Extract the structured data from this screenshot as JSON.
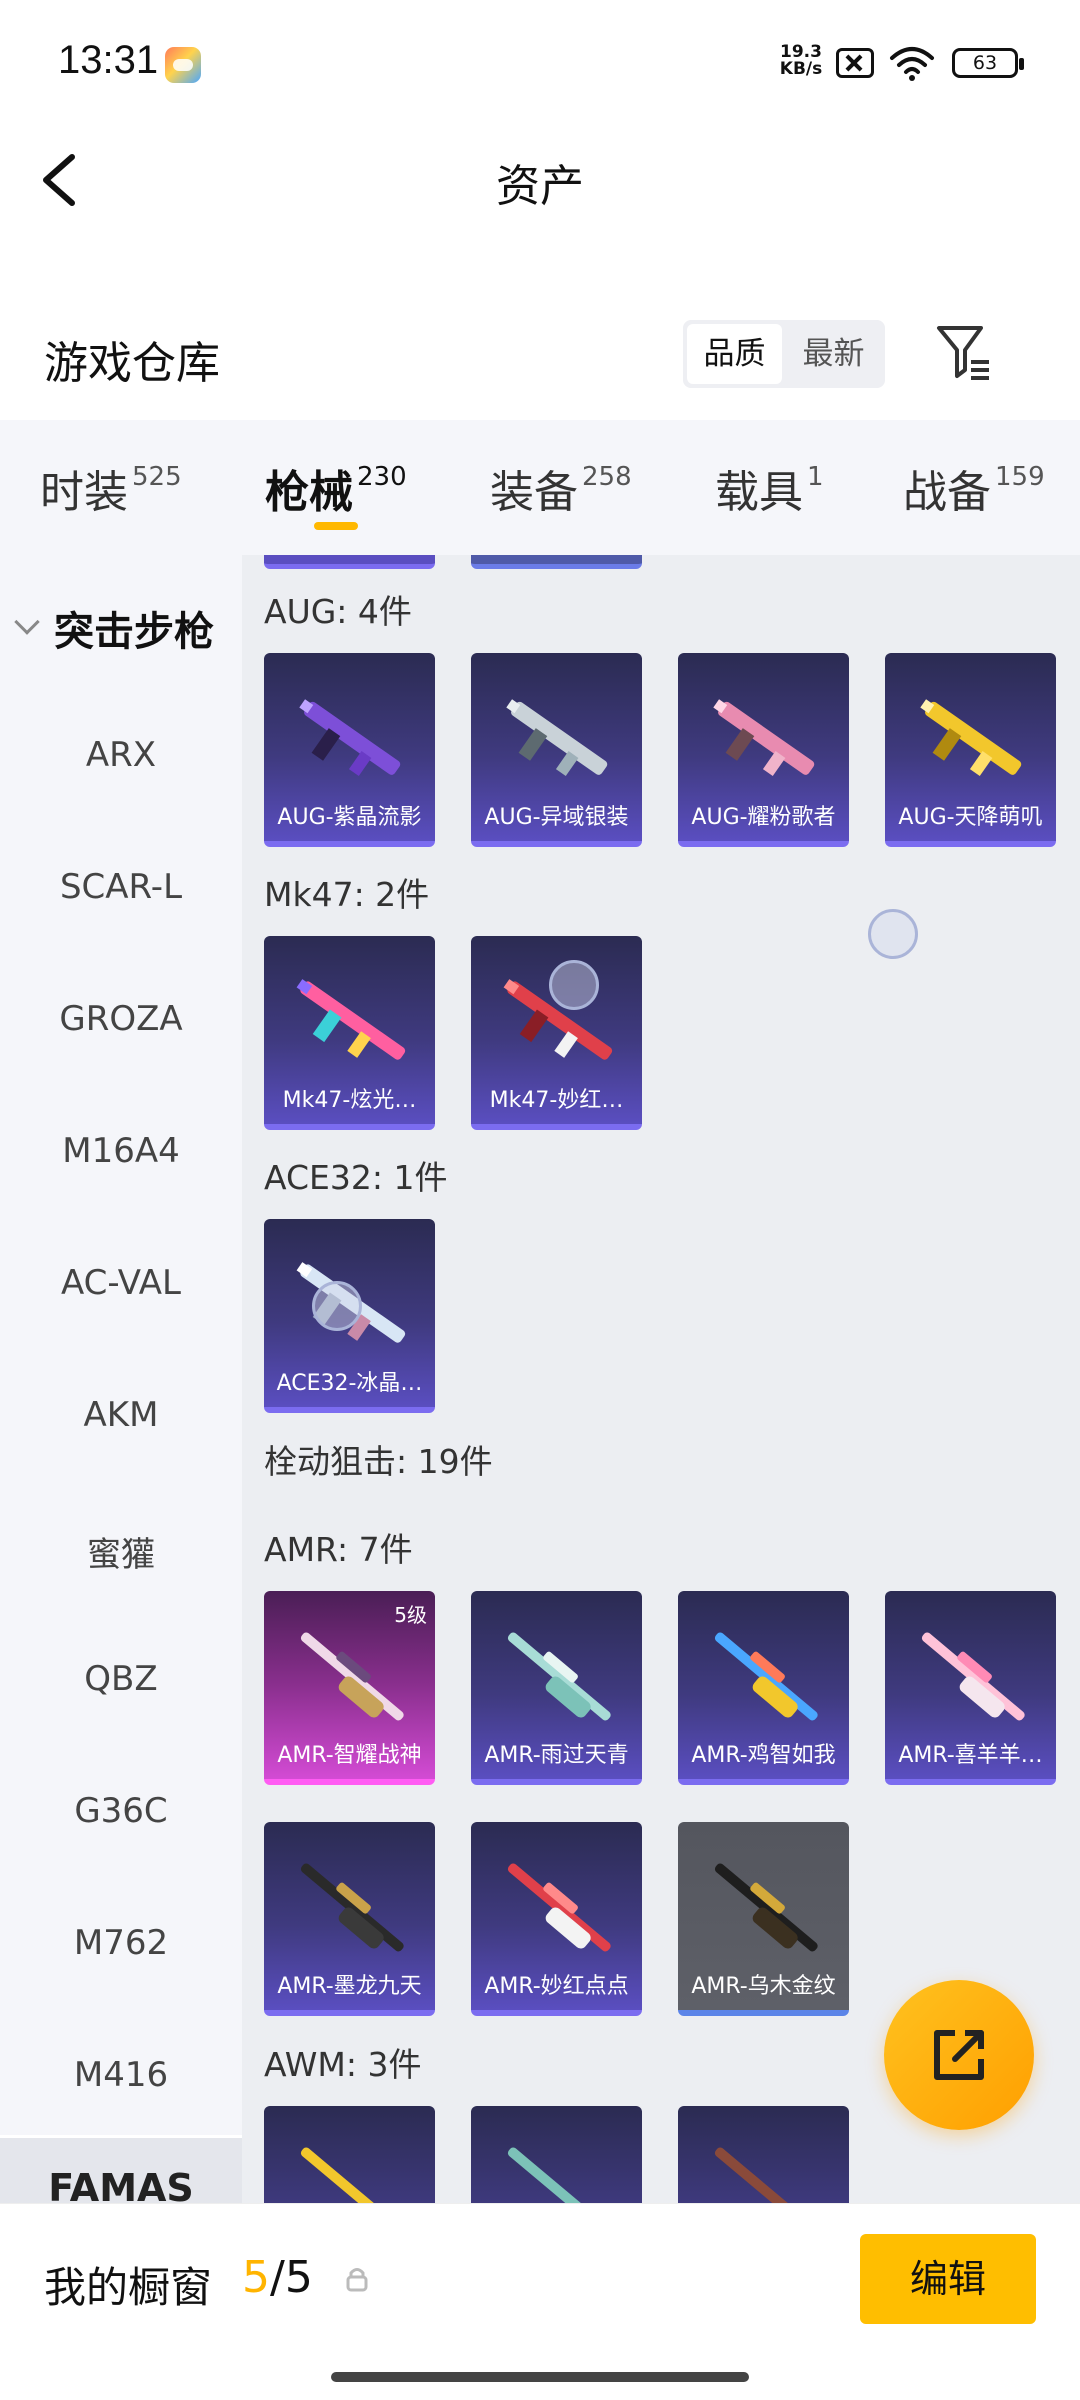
{
  "status": {
    "time": "13:31",
    "net_speed_value": "19.3",
    "net_speed_unit": "KB/s",
    "battery": "63"
  },
  "header": {
    "title": "资产"
  },
  "warehouse": {
    "title": "游戏仓库",
    "sort_quality": "品质",
    "sort_newest": "最新"
  },
  "tabs": [
    {
      "label": "时装",
      "count": "525"
    },
    {
      "label": "枪械",
      "count": "230",
      "active": true
    },
    {
      "label": "装备",
      "count": "258"
    },
    {
      "label": "载具",
      "count": "1"
    },
    {
      "label": "战备",
      "count": "159"
    }
  ],
  "sidebar": {
    "group": "突击步枪",
    "items": [
      "ARX",
      "SCAR-L",
      "GROZA",
      "M16A4",
      "AC-VAL",
      "AKM",
      "蜜獾",
      "QBZ",
      "G36C",
      "M762",
      "M416"
    ],
    "next_group": "FAMAS"
  },
  "sections": {
    "aug": {
      "title": "AUG: 4件",
      "items": [
        "AUG-紫晶流影",
        "AUG-异域银装",
        "AUG-耀粉歌者",
        "AUG-天降萌叽"
      ]
    },
    "mk47": {
      "title": "Mk47: 2件",
      "items": [
        "Mk47-炫光…",
        "Mk47-妙红…"
      ]
    },
    "ace32": {
      "title": "ACE32: 1件",
      "items": [
        "ACE32-冰晶…"
      ]
    },
    "bolt_title": "栓动狙击: 19件",
    "amr": {
      "title": "AMR: 7件",
      "items": [
        "AMR-智耀战神",
        "AMR-雨过天青",
        "AMR-鸡智如我",
        "AMR-喜羊羊…",
        "AMR-墨龙九天",
        "AMR-妙红点点",
        "AMR-乌木金纹"
      ],
      "badge": "5级"
    },
    "awm": {
      "title": "AWM: 3件"
    }
  },
  "bottom": {
    "showcase_label": "我的橱窗",
    "used": "5",
    "total": "/5",
    "edit_label": "编辑"
  },
  "colors": {
    "accent": "#ffb800",
    "card_purple": "#3f3a7f",
    "card_legendary": "#d34bd4",
    "card_grey": "#5e6068"
  }
}
